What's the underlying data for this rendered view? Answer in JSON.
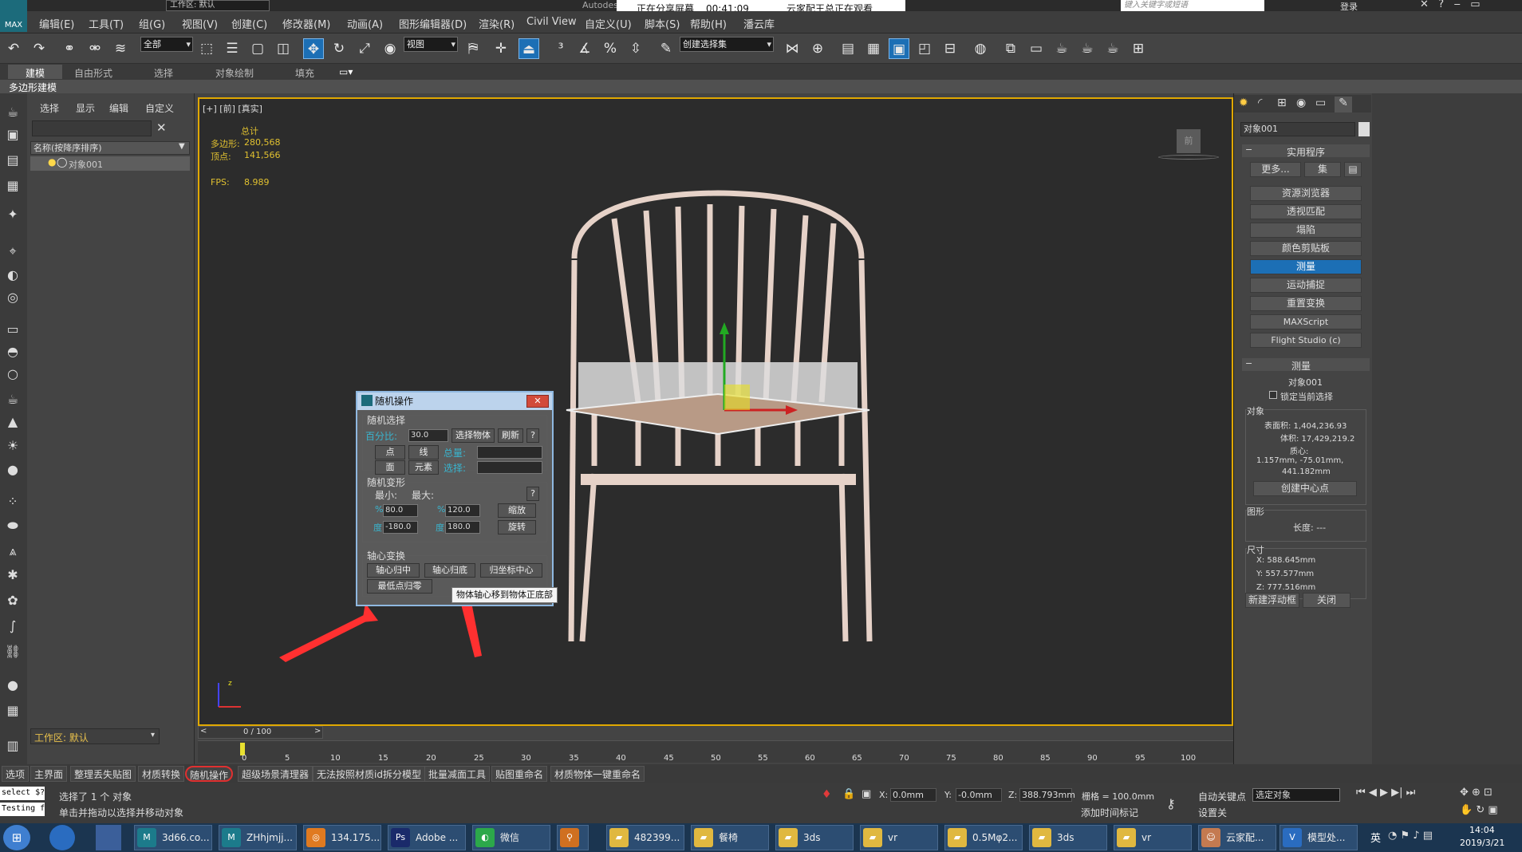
{
  "window": {
    "workspace": "工作区: 默认",
    "brand": "Autodes",
    "search_placeholder": "键入关键字或短语",
    "login": "登录"
  },
  "share": {
    "status": "正在分享屏幕",
    "time": "00:41:09",
    "viewers": "云家配王总正在观看"
  },
  "menus": [
    "编辑(E)",
    "工具(T)",
    "组(G)",
    "视图(V)",
    "创建(C)",
    "修改器(M)",
    "动画(A)",
    "图形编辑器(D)",
    "渲染(R)",
    "Civil View",
    "自定义(U)",
    "脚本(S)",
    "帮助(H)",
    "潘云库"
  ],
  "toolbar": {
    "filter": "全部",
    "ref_coord": "视图",
    "selection_set": "创建选择集"
  },
  "ribbon": {
    "tabs": [
      "建模",
      "自由形式",
      "选择",
      "对象绘制",
      "填充"
    ],
    "sub": "多边形建模"
  },
  "scene_explorer": {
    "tabs": [
      "选择",
      "显示",
      "编辑",
      "自定义"
    ],
    "column": "名称(按降序排序)",
    "items": [
      "对象001"
    ],
    "workspace": "工作区: 默认"
  },
  "viewport": {
    "label": "[+] [前] [真实]",
    "stats_title": "总计",
    "poly_label": "多边形:",
    "poly_value": "280,568",
    "vert_label": "顶点:",
    "vert_value": "141,566",
    "fps_label": "FPS:",
    "fps_value": "8.989",
    "viewcube": "前"
  },
  "dialog": {
    "title": "随机操作",
    "g1": "随机选择",
    "pct_label": "百分比:",
    "pct_value": "30.0",
    "btn_select": "选择物体",
    "btn_refresh": "刷新",
    "help": "?",
    "btn_point": "点",
    "btn_line": "线",
    "total_label": "总量:",
    "btn_face": "面",
    "btn_elem": "元素",
    "sel_label": "选择:",
    "g2": "随机变形",
    "min_label": "最小:",
    "max_label": "最大:",
    "pmin": "80.0",
    "pmax": "120.0",
    "btn_scale": "缩放",
    "dmin": "-180.0",
    "dmax": "180.0",
    "btn_rotate": "旋转",
    "pct_sym": "%",
    "deg_sym": "度",
    "g3": "轴心变换",
    "btn_center": "轴心归中",
    "btn_bottom": "轴心归底",
    "btn_origin": "归坐标中心",
    "btn_lowest": "最低点归零",
    "tooltip": "物体轴心移到物体正底部"
  },
  "command_panel": {
    "object_name": "对象001",
    "utilities_title": "实用程序",
    "btn_more": "更多...",
    "btn_sets": "集",
    "utilities": [
      "资源浏览器",
      "透视匹配",
      "塌陷",
      "颜色剪贴板",
      "测量",
      "运动捕捉",
      "重置变换",
      "MAXScript",
      "Flight Studio (c)"
    ],
    "selected_utility": "测量",
    "measure_title": "测量",
    "measure_obj": "对象001",
    "lock_label": "锁定当前选择",
    "obj_group": "对象",
    "surface": "表面积: 1,404,236.93",
    "volume": "体积: 17,429,219.2",
    "centroid_label": "质心:",
    "centroid": "1.157mm, -75.01mm,",
    "centroid2": "441.182mm",
    "btn_create_center": "创建中心点",
    "shape_group": "图形",
    "length": "长度: ---",
    "dim_group": "尺寸",
    "dim_x": "X:  588.645mm",
    "dim_y": "Y:  557.577mm",
    "dim_z": "Z:  777.516mm",
    "btn_new_float": "新建浮动框",
    "btn_close": "关闭"
  },
  "timeline": {
    "frame": "0 / 100",
    "ticks": [
      "0",
      "5",
      "10",
      "15",
      "20",
      "25",
      "30",
      "35",
      "40",
      "45",
      "50",
      "55",
      "60",
      "65",
      "70",
      "75",
      "80",
      "85",
      "90",
      "95",
      "100"
    ]
  },
  "script_tabs": [
    "选项",
    "主界面",
    "整理丢失贴图",
    "材质转换",
    "随机操作",
    "超级场景清理器",
    "无法按照材质id拆分模型",
    "批量减面工具",
    "贴图重命名",
    "材质物体一键重命名"
  ],
  "status": {
    "script1": "select $?",
    "script2": "Testing f",
    "msg1": "选择了 1 个 对象",
    "msg2": "单击并拖动以选择并移动对象",
    "x_label": "X:",
    "x": "0.0mm",
    "y_label": "Y:",
    "y": "-0.0mm",
    "z_label": "Z:",
    "z": "388.793mm",
    "grid": "栅格 = 100.0mm",
    "add_time": "添加时间标记",
    "auto_key": "自动关键点",
    "set_key": "设置关",
    "key_filter": "选定对象"
  },
  "taskbar": {
    "items": [
      "3d66.co...",
      "ZHhjmjj...",
      "134.175...",
      "Adobe ...",
      "微信",
      "",
      "482399...",
      "餐椅",
      "3ds",
      "vr",
      "0.5Mφ2...",
      "3ds",
      "vr",
      "云家配...",
      "模型处..."
    ],
    "time": "14:04",
    "date": "2019/3/21",
    "ime": "英"
  },
  "colors": {
    "accent": "#1c6fb5",
    "viewport_border": "#e0a800"
  }
}
